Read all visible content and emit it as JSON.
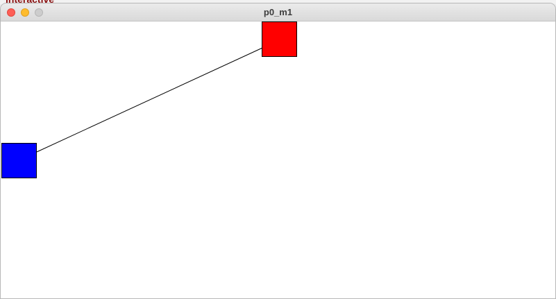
{
  "background_window": {
    "title_fragment": "interactive"
  },
  "window": {
    "title": "p0_m1",
    "buttons": {
      "close": "close-button",
      "minimize": "minimize-button",
      "zoom": "zoom-button"
    }
  },
  "canvas": {
    "background_color": "#ffffff",
    "nodes": [
      {
        "id": "red-square",
        "fill": "#ff0000",
        "stroke": "#000000"
      },
      {
        "id": "blue-square",
        "fill": "#0000ff",
        "stroke": "#000000"
      }
    ],
    "edge": {
      "from": "blue-square",
      "to": "red-square",
      "color": "#000000"
    }
  }
}
